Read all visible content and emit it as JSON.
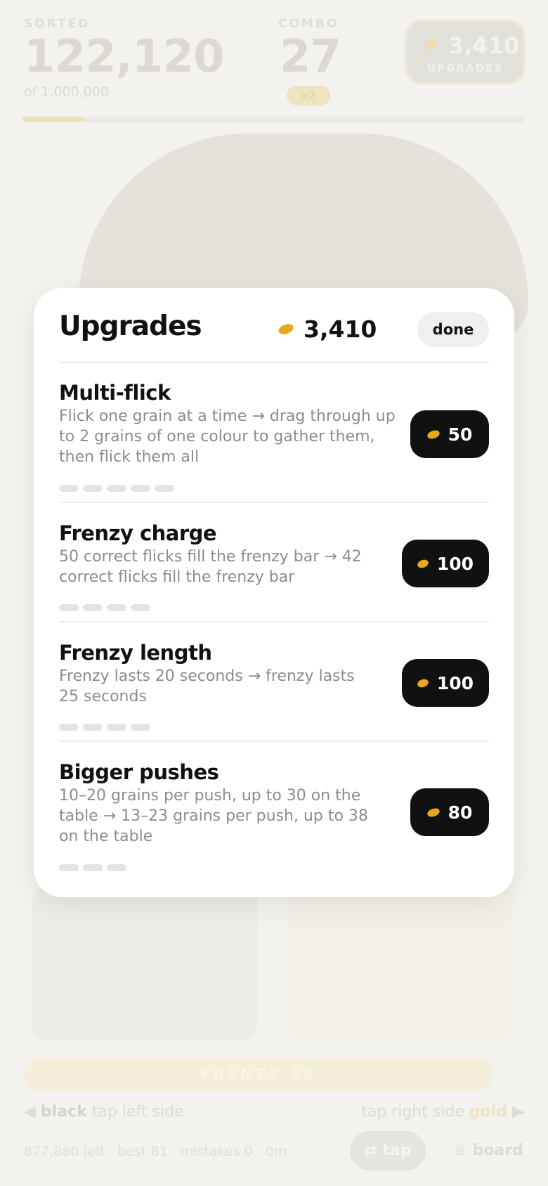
{
  "background": {
    "sorted_label": "SORTED",
    "sorted_value": "122,120",
    "sorted_of": "of 1,000,000",
    "combo_label": "COMBO",
    "combo_value": "27",
    "combo_badge": "x2",
    "upgrades_balance": "3,410",
    "upgrades_label": "UPGRADES",
    "sorted_progress": 0.122,
    "frenzy_label": "FRENZY 18",
    "left_side_color": "black",
    "left_side_hint": "tap left side",
    "right_side_color": "gold",
    "right_side_hint": "tap right side",
    "footer_info": "877,880 left · best 81 · mistakes 0 · 0m",
    "tap_label": "tap",
    "board_label": "board"
  },
  "modal": {
    "title": "Upgrades",
    "balance": "3,410",
    "done_label": "done",
    "coin_color": "#e9a81c",
    "upgrades": [
      {
        "name": "Multi-flick",
        "description": "Flick one grain at a time → drag through up to 2 grains of one colour to gather them, then flick them all",
        "price": "50",
        "levels": 5
      },
      {
        "name": "Frenzy charge",
        "description": "50 correct flicks fill the frenzy bar → 42 correct flicks fill the frenzy bar",
        "price": "100",
        "levels": 4
      },
      {
        "name": "Frenzy length",
        "description": "Frenzy lasts 20 seconds → frenzy lasts 25 seconds",
        "price": "100",
        "levels": 4
      },
      {
        "name": "Bigger pushes",
        "description": "10–20 grains per push, up to 30 on the table → 13–23 grains per push, up to 38 on the table",
        "price": "80",
        "levels": 3
      }
    ]
  }
}
